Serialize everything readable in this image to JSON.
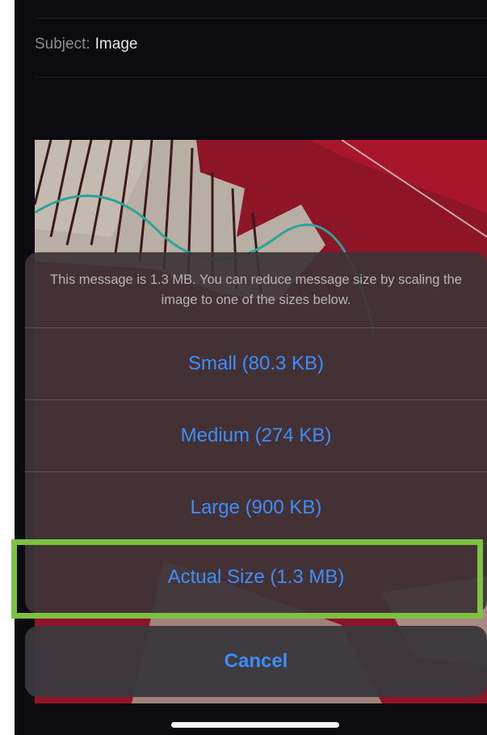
{
  "header": {
    "subject_label": "Subject:",
    "subject_value": "Image"
  },
  "attachment": {
    "icon": "photo-thumbnail"
  },
  "action_sheet": {
    "message": "This message is 1.3 MB. You can reduce message size by scaling the image to one of the sizes below.",
    "options": [
      {
        "label": "Small (80.3 KB)"
      },
      {
        "label": "Medium (274 KB)"
      },
      {
        "label": "Large (900 KB)"
      },
      {
        "label": "Actual Size (1.3 MB)"
      }
    ],
    "cancel_label": "Cancel"
  },
  "colors": {
    "accent": "#3d8ef8",
    "highlight": "#7cc142",
    "background": "#0c0c10"
  }
}
